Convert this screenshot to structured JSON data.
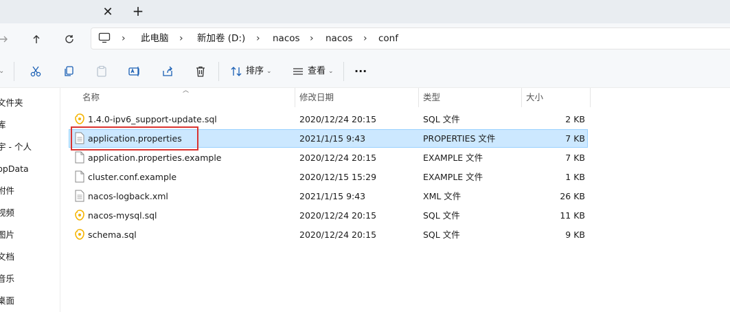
{
  "titlebar": {
    "close_glyph": "✕",
    "new_tab_glyph": "+"
  },
  "address": {
    "crumbs": [
      "此电脑",
      "新加卷 (D:)",
      "nacos",
      "nacos",
      "conf"
    ]
  },
  "commands": {
    "sort_label": "排序",
    "view_label": "查看",
    "more_glyph": "···"
  },
  "nav_pane": {
    "items": [
      "文件夹",
      "库",
      "宇 - 个人",
      "ppData",
      "附件",
      "视频",
      "图片",
      "文档",
      "音乐",
      "桌面"
    ]
  },
  "columns": {
    "name": "名称",
    "date": "修改日期",
    "type": "类型",
    "size": "大小"
  },
  "files": [
    {
      "name": "1.4.0-ipv6_support-update.sql",
      "date": "2020/12/24 20:15",
      "type": "SQL 文件",
      "size": "2 KB",
      "icon": "sql-file-icon"
    },
    {
      "name": "application.properties",
      "date": "2021/1/15 9:43",
      "type": "PROPERTIES 文件",
      "size": "7 KB",
      "icon": "text-file-icon"
    },
    {
      "name": "application.properties.example",
      "date": "2020/12/24 20:15",
      "type": "EXAMPLE 文件",
      "size": "7 KB",
      "icon": "blank-file-icon"
    },
    {
      "name": "cluster.conf.example",
      "date": "2020/12/15 15:29",
      "type": "EXAMPLE 文件",
      "size": "1 KB",
      "icon": "blank-file-icon"
    },
    {
      "name": "nacos-logback.xml",
      "date": "2021/1/15 9:43",
      "type": "XML 文件",
      "size": "26 KB",
      "icon": "text-file-icon"
    },
    {
      "name": "nacos-mysql.sql",
      "date": "2020/12/24 20:15",
      "type": "SQL 文件",
      "size": "11 KB",
      "icon": "sql-file-icon"
    },
    {
      "name": "schema.sql",
      "date": "2020/12/24 20:15",
      "type": "SQL 文件",
      "size": "9 KB",
      "icon": "sql-file-icon"
    }
  ],
  "colors": {
    "selection": "#cce8ff",
    "selection_border": "#99d1ff",
    "highlight": "#d9322f",
    "sql_icon": "#f4c430"
  }
}
